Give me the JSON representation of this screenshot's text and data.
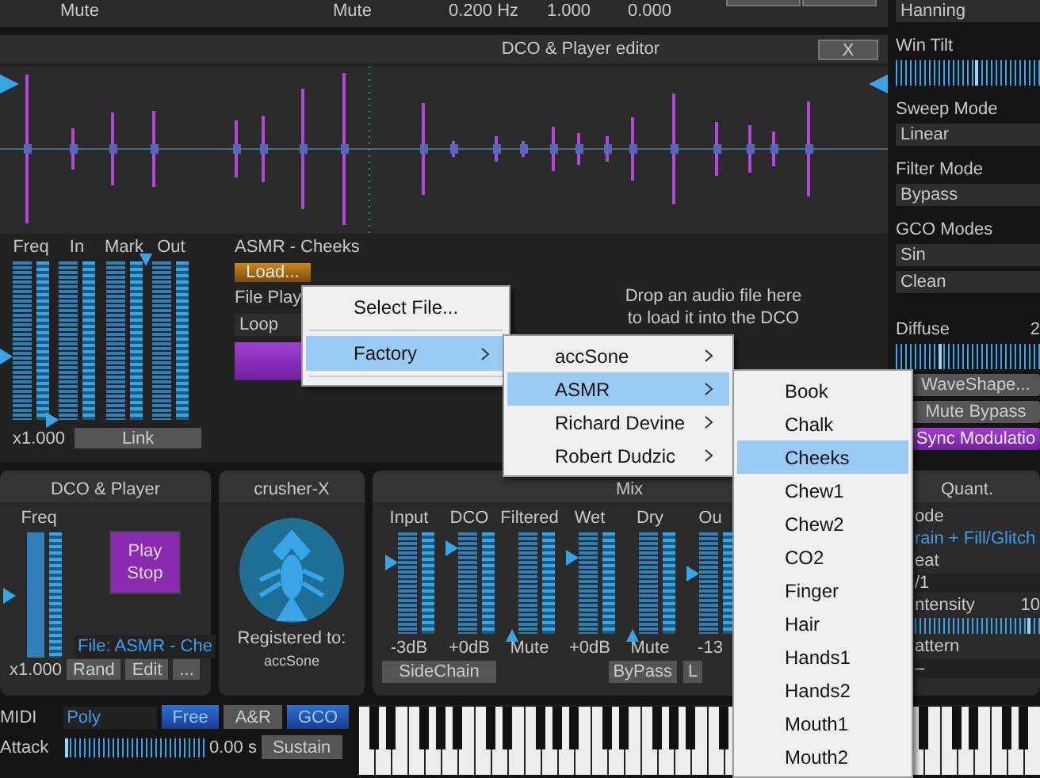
{
  "top_strip": {
    "cells": [
      "Mute",
      "Mute",
      "0.200 Hz",
      "1.000",
      "0.000"
    ]
  },
  "editor": {
    "title": "DCO & Player editor",
    "close": "X",
    "faders": [
      {
        "label": "Freq",
        "level": 0.4
      },
      {
        "label": "In",
        "level": 0
      },
      {
        "label": "Mark"
      },
      {
        "label": "Out",
        "level": 1
      }
    ],
    "multiplier": "x1.000",
    "link": "Link",
    "sample_name": "ASMR - Cheeks",
    "load": "Load...",
    "file_play_label": "File Play",
    "play_mode": "Loop",
    "drop_hint": "Drop an audio file here to load it into the DCO"
  },
  "sidebar": {
    "window": "Hanning",
    "win_tilt": {
      "label": "Win Tilt",
      "level": 0.55
    },
    "sweep_mode": {
      "label": "Sweep Mode",
      "value": "Linear"
    },
    "filter_mode": {
      "label": "Filter Mode",
      "value": "Bypass"
    },
    "gco_modes": {
      "label": "GCO Modes",
      "values": [
        "Sin",
        "Clean"
      ]
    },
    "diffuse": {
      "label": "Diffuse",
      "reading": "2",
      "level": 0.3
    },
    "buttons": [
      {
        "label": "WaveShape...",
        "kind": "plain"
      },
      {
        "label": "Mute Bypass",
        "kind": "plain"
      },
      {
        "label": "Sync Modulatio",
        "kind": "accent"
      }
    ]
  },
  "dco_player": {
    "title": "DCO & Player",
    "freq": {
      "label": "Freq",
      "level": 0.5
    },
    "play_stop": "Play Stop",
    "file": "File: ASMR - Che",
    "multiplier": "x1.000",
    "buttons": [
      "Rand",
      "Edit",
      "..."
    ]
  },
  "crusher": {
    "title": "crusher-X",
    "registered_label": "Registered to:",
    "registered_name": "accSone"
  },
  "mix": {
    "title": "Mix",
    "faders": [
      {
        "label": "Input",
        "level": 0.7,
        "reading": "-3dB"
      },
      {
        "label": "DCO",
        "level": 0.85,
        "reading": "+0dB"
      },
      {
        "label": "Filtered",
        "level": 0,
        "reading": "Mute"
      },
      {
        "label": "Wet",
        "level": 0.75,
        "reading": "+0dB"
      },
      {
        "label": "Dry",
        "level": 0,
        "reading": "Mute"
      },
      {
        "label": "Ou",
        "level": 0.6,
        "reading": "-13"
      }
    ],
    "buttons": [
      {
        "label": "SideChain"
      },
      {
        "label": "ByPass"
      },
      {
        "label": "L"
      }
    ]
  },
  "quant": {
    "title": "Quant.",
    "rows": [
      {
        "kind": "label",
        "text": "ode"
      },
      {
        "kind": "value",
        "text": "rain + Fill/Glitch"
      },
      {
        "kind": "label",
        "text": "eat"
      },
      {
        "kind": "field",
        "text": "/1"
      },
      {
        "kind": "label",
        "text": "ntensity",
        "reading": "10"
      },
      {
        "kind": "slider",
        "level": 0.9
      },
      {
        "kind": "label",
        "text": "attern"
      },
      {
        "kind": "field",
        "text": "–"
      }
    ]
  },
  "bottom": {
    "midi_label": "MIDI",
    "voice_mode": "Poly",
    "toggles": [
      {
        "label": "Free",
        "on": true
      },
      {
        "label": "A&R",
        "on": false
      },
      {
        "label": "GCO",
        "on": true
      }
    ],
    "attack": {
      "label": "Attack",
      "level": 0,
      "reading": "0.00 s"
    },
    "sustain": {
      "label": "Sustain",
      "on": false
    }
  },
  "load_menu": {
    "items": [
      {
        "label": "Select File...",
        "has_submenu": false,
        "selected": false
      },
      {
        "label": "Factory",
        "has_submenu": true,
        "selected": true
      }
    ]
  },
  "factory_menu": {
    "items": [
      {
        "label": "accSone",
        "has_submenu": true,
        "selected": false
      },
      {
        "label": "ASMR",
        "has_submenu": true,
        "selected": true
      },
      {
        "label": "Richard Devine",
        "has_submenu": true,
        "selected": false
      },
      {
        "label": "Robert Dudzic",
        "has_submenu": true,
        "selected": false
      }
    ]
  },
  "asmr_menu": {
    "items": [
      {
        "label": "Book",
        "selected": false
      },
      {
        "label": "Chalk",
        "selected": false
      },
      {
        "label": "Cheeks",
        "selected": true
      },
      {
        "label": "Chew1",
        "selected": false
      },
      {
        "label": "Chew2",
        "selected": false
      },
      {
        "label": "CO2",
        "selected": false
      },
      {
        "label": "Finger",
        "selected": false
      },
      {
        "label": "Hair",
        "selected": false
      },
      {
        "label": "Hands1",
        "selected": false
      },
      {
        "label": "Hands2",
        "selected": false
      },
      {
        "label": "Mouth1",
        "selected": false
      },
      {
        "label": "Mouth2",
        "selected": false
      }
    ]
  }
}
